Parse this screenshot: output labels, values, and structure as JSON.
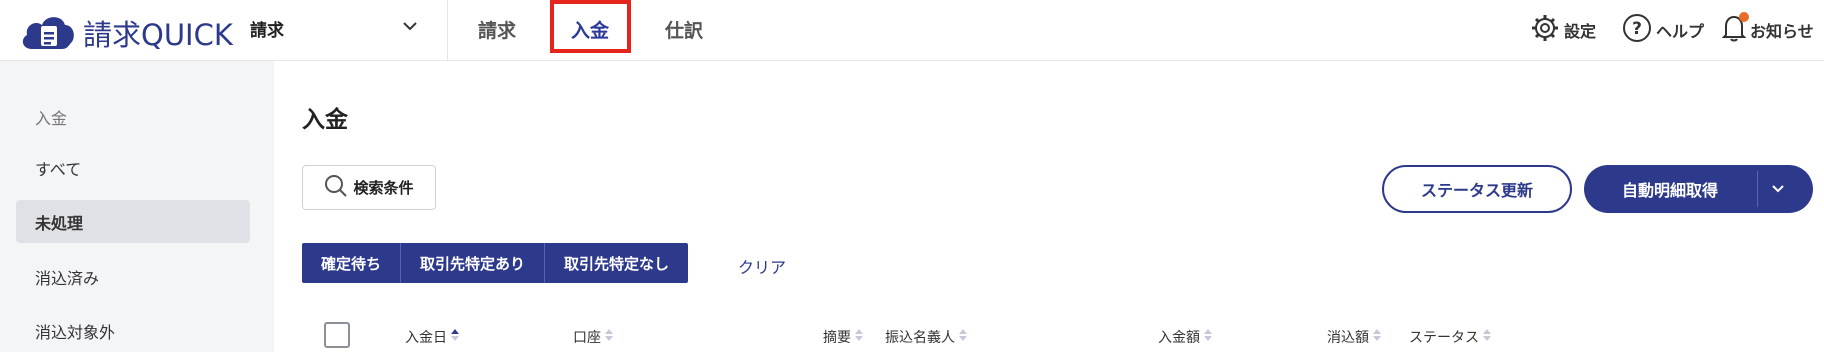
{
  "header": {
    "logo_text": "請求QUICK",
    "app_selector": "請求",
    "tabs": [
      {
        "label": "請求"
      },
      {
        "label": "入金"
      },
      {
        "label": "仕訳"
      }
    ],
    "settings_label": "設定",
    "help_label": "ヘルプ",
    "notifications_label": "お知らせ"
  },
  "sidebar": {
    "heading": "入金",
    "items": [
      {
        "label": "すべて"
      },
      {
        "label": "未処理"
      },
      {
        "label": "消込済み"
      },
      {
        "label": "消込対象外"
      }
    ]
  },
  "main": {
    "title": "入金",
    "search_label": "検索条件",
    "status_update_label": "ステータス更新",
    "auto_fetch_label": "自動明細取得",
    "filters": [
      {
        "label": "確定待ち"
      },
      {
        "label": "取引先特定あり"
      },
      {
        "label": "取引先特定なし"
      }
    ],
    "clear_label": "クリア",
    "columns": [
      {
        "label": "入金日"
      },
      {
        "label": "口座"
      },
      {
        "label": "摘要"
      },
      {
        "label": "振込名義人"
      },
      {
        "label": "入金額"
      },
      {
        "label": "消込額"
      },
      {
        "label": "ステータス"
      }
    ]
  },
  "colors": {
    "brand": "#2d3a8c",
    "highlight": "#e5251b",
    "notification_dot": "#e96b28"
  }
}
